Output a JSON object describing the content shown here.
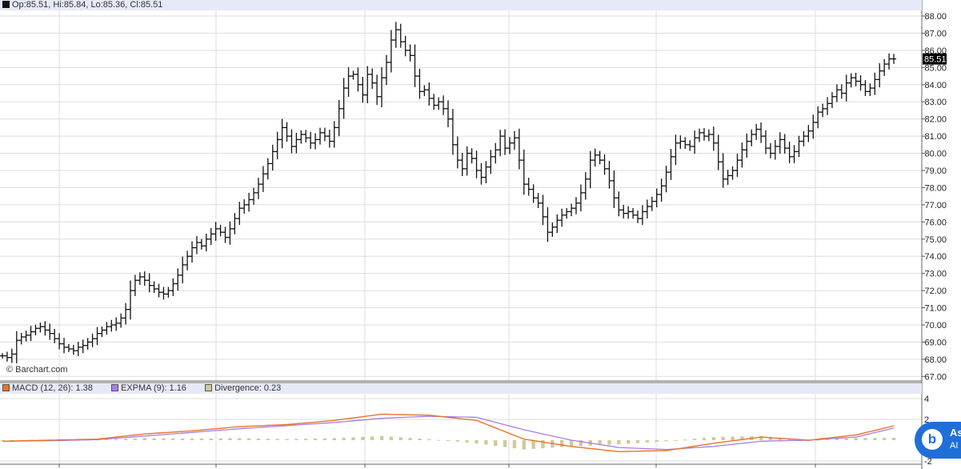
{
  "header": {
    "ohlc_text": "Op:85.51, Hi:85.84, Lo:85.36, Cl:85.51",
    "credit": "© Barchart.com"
  },
  "ai_button": {
    "title": "As",
    "subtitle": "AI"
  },
  "colors": {
    "header_bg": "#e6e9f7",
    "grid": "#dddddd",
    "bars": "#111111",
    "macd": "#e8742a",
    "expma": "#a97de6",
    "divergence": "#cfca98",
    "accent": "#1f6fd8"
  },
  "chart_data": [
    {
      "type": "ohlc",
      "y_ticks": [
        "88.00",
        "87.00",
        "86.00",
        "85.00",
        "84.00",
        "83.00",
        "82.00",
        "81.00",
        "80.00",
        "79.00",
        "78.00",
        "77.00",
        "76.00",
        "75.00",
        "74.00",
        "73.00",
        "72.00",
        "71.00",
        "70.00",
        "69.00",
        "68.00",
        "67.00"
      ],
      "ylim": [
        67,
        88.3
      ],
      "last_price_label": "85.51",
      "grid": true,
      "close": [
        68.2,
        68.1,
        68.3,
        69.1,
        69.3,
        69.4,
        69.6,
        69.8,
        69.9,
        69.7,
        69.5,
        69.2,
        68.9,
        68.7,
        68.6,
        68.5,
        68.7,
        68.8,
        69.0,
        69.2,
        69.5,
        69.7,
        69.9,
        70.0,
        70.1,
        70.4,
        70.9,
        72.0,
        72.6,
        72.8,
        72.6,
        72.3,
        72.1,
        71.9,
        71.8,
        72.0,
        72.4,
        72.9,
        73.5,
        74.0,
        74.5,
        74.8,
        74.6,
        75.0,
        75.3,
        75.6,
        75.4,
        75.1,
        75.6,
        76.2,
        76.8,
        77.0,
        77.3,
        77.7,
        78.2,
        78.8,
        79.4,
        80.1,
        80.8,
        81.5,
        81.0,
        80.4,
        80.8,
        81.1,
        80.9,
        80.6,
        80.8,
        81.2,
        81.0,
        80.7,
        81.5,
        82.6,
        83.8,
        84.5,
        84.6,
        84.0,
        83.4,
        84.6,
        84.1,
        83.3,
        84.4,
        85.3,
        86.6,
        87.2,
        86.5,
        86.0,
        85.7,
        84.5,
        83.6,
        83.7,
        83.2,
        82.8,
        83.0,
        82.6,
        82.0,
        80.5,
        79.6,
        79.1,
        80.0,
        79.7,
        79.0,
        78.6,
        79.2,
        79.8,
        80.2,
        81.0,
        80.3,
        80.6,
        80.9,
        79.6,
        78.2,
        77.9,
        77.4,
        77.1,
        76.3,
        75.4,
        75.7,
        76.1,
        76.4,
        76.6,
        76.8,
        77.1,
        77.7,
        78.5,
        79.6,
        79.9,
        79.6,
        79.1,
        78.4,
        77.4,
        76.7,
        76.5,
        76.6,
        76.4,
        76.2,
        76.6,
        76.9,
        77.2,
        77.6,
        78.1,
        78.9,
        79.8,
        80.6,
        80.7,
        80.5,
        80.4,
        80.9,
        81.2,
        81.0,
        81.1,
        80.6,
        79.5,
        78.5,
        78.7,
        79.0,
        79.6,
        80.2,
        80.7,
        81.1,
        81.4,
        81.0,
        80.3,
        80.0,
        80.4,
        80.8,
        80.3,
        79.8,
        80.1,
        80.7,
        81.0,
        81.3,
        81.8,
        82.4,
        82.6,
        82.9,
        83.3,
        83.7,
        83.5,
        84.1,
        84.4,
        84.2,
        84.0,
        83.6,
        83.8,
        84.3,
        84.8,
        85.2,
        85.5,
        85.5
      ]
    },
    {
      "type": "macd",
      "legend": [
        "MACD (12, 26): 1.38",
        "EXPMA (9): 1.16",
        "Divergence: 0.23"
      ],
      "y_ticks": [
        "4",
        "2",
        "-2"
      ],
      "ylim": [
        -2,
        5
      ],
      "x": [
        0,
        10,
        20,
        30,
        40,
        50,
        60,
        70,
        80,
        90,
        100,
        110,
        120,
        130,
        140,
        150,
        160,
        170,
        180,
        188
      ],
      "macd": [
        -0.1,
        0.0,
        0.1,
        0.6,
        0.9,
        1.3,
        1.5,
        1.9,
        2.5,
        2.4,
        1.9,
        0.1,
        -0.6,
        -1.1,
        -1.0,
        -0.3,
        0.3,
        0.0,
        0.5,
        1.38
      ],
      "expma": [
        -0.1,
        -0.05,
        0.05,
        0.4,
        0.75,
        1.1,
        1.4,
        1.7,
        2.1,
        2.3,
        2.2,
        1.0,
        0.0,
        -0.7,
        -0.9,
        -0.6,
        -0.1,
        0.0,
        0.3,
        1.16
      ],
      "divergence_bars": [
        0.0,
        0.05,
        0.05,
        0.2,
        0.15,
        0.2,
        0.1,
        0.2,
        0.4,
        0.1,
        -0.3,
        -0.9,
        -0.6,
        -0.4,
        -0.1,
        0.3,
        0.4,
        0.0,
        0.2,
        0.23
      ]
    }
  ]
}
